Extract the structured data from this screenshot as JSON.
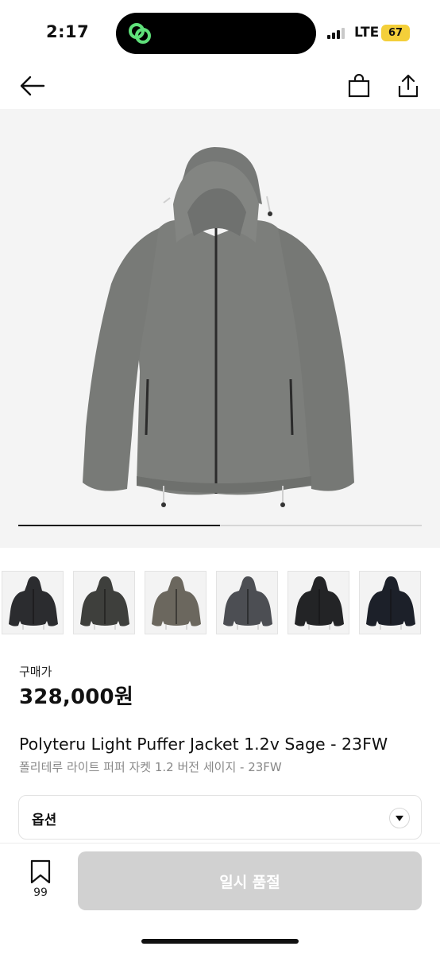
{
  "status_bar": {
    "time": "2:17",
    "network": "LTE",
    "battery": "67",
    "battery_color": "#f4cf3a",
    "island_icon": "link-loop-icon",
    "island_icon_color": "#5fe07a"
  },
  "nav": {
    "back_icon": "arrow-left-icon",
    "bag_icon": "shopping-bag-icon",
    "share_icon": "share-icon"
  },
  "gallery": {
    "main_image": "gray-hooded-puffer-jacket",
    "progress": 0.5,
    "thumbnails": [
      {
        "color": "#2b2c2f"
      },
      {
        "color": "#3e3f3c"
      },
      {
        "color": "#6b675e"
      },
      {
        "color": "#4c4e53"
      },
      {
        "color": "#232426"
      },
      {
        "color": "#1c2029"
      }
    ]
  },
  "product": {
    "price_label": "구매가",
    "price": "328,000원",
    "name_en": "Polyteru Light Puffer Jacket 1.2v Sage - 23FW",
    "name_ko": "폴리테루 라이트 퍼퍼 자켓 1.2 버전 세이지 - 23FW"
  },
  "option": {
    "label": "옵션",
    "arrow_icon": "caret-down-icon"
  },
  "bottom": {
    "bookmark_icon": "bookmark-icon",
    "bookmark_count": "99",
    "soldout_label": "일시 품절",
    "soldout_color": "#d1d1d1"
  }
}
